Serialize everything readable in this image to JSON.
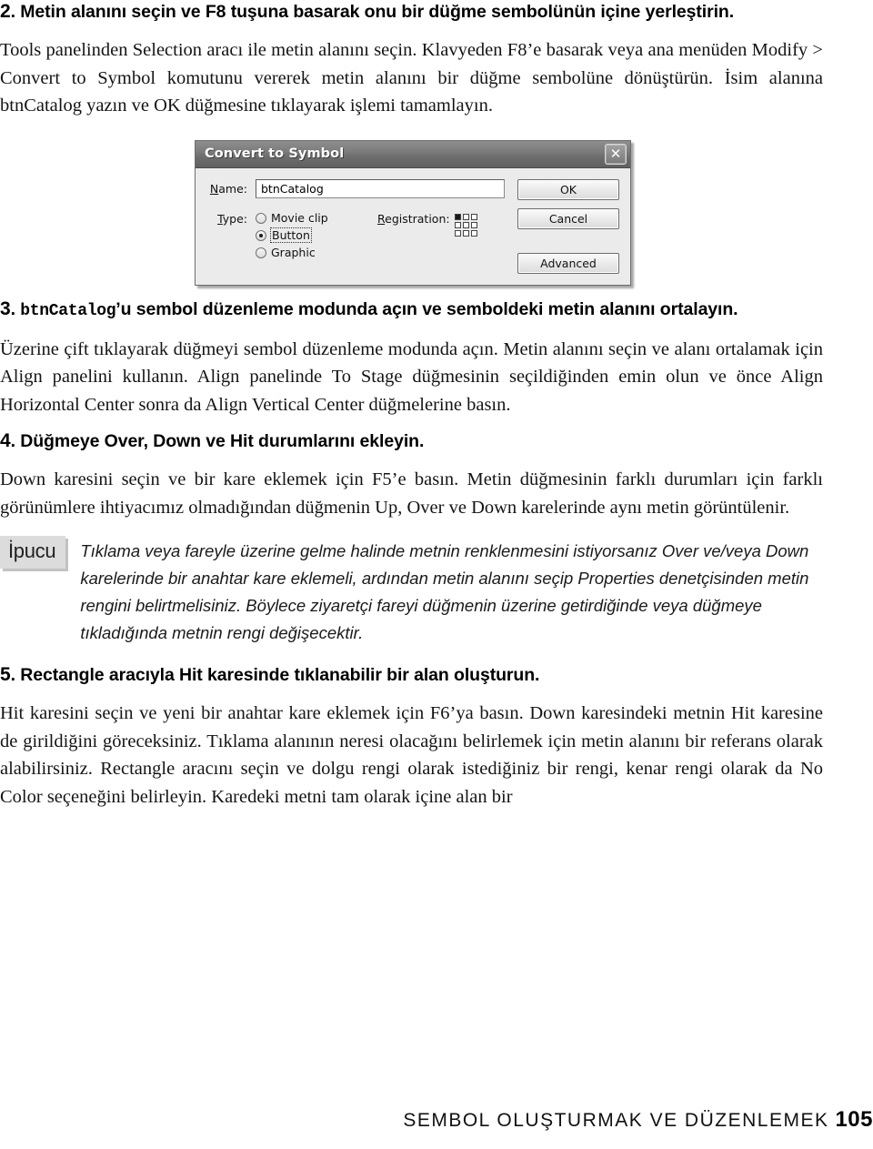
{
  "page": {
    "number": "105",
    "footer_title": "SEMBOL OLUŞTURMAK VE DÜZENLEMEK"
  },
  "steps": [
    {
      "number": "2",
      "heading_rest": ". Metin alanını seçin ve F8 tuşuna basarak onu bir düğme sembolünün içine yerleştirin.",
      "paragraph": "Tools panelinden Selection aracı ile metin alanını seçin. Klavyeden F8’e basarak veya ana menüden Modify > Convert to Symbol komutunu vererek metin alanını bir düğme sembolüne dönüştürün. İsim alanına btnCatalog yazın ve OK düğmesine tıklayarak işlemi tamamlayın."
    },
    {
      "number": "3",
      "heading_mono": "btnCatalog",
      "heading_rest": "’u sembol düzenleme modunda açın ve semboldeki metin alanını ortalayın.",
      "paragraph": "Üzerine çift tıklayarak düğmeyi sembol düzenleme modunda açın. Metin alanını seçin ve alanı ortalamak için Align panelini kullanın. Align panelinde To Stage düğmesinin seçildiğinden emin olun ve önce Align Horizontal Center sonra da Align Vertical Center düğmelerine basın."
    },
    {
      "number": "4",
      "heading_rest": ". Düğmeye Over, Down ve Hit durumlarını ekleyin.",
      "paragraph": "Down karesini seçin ve bir kare eklemek için F5’e basın. Metin düğmesinin farklı durumları için farklı görünümlere ihtiyacımız olmadığından düğmenin Up, Over ve Down karelerinde aynı metin görüntülenir."
    },
    {
      "number": "5",
      "heading_rest": ". Rectangle aracıyla Hit karesinde tıklanabilir bir alan oluşturun.",
      "paragraph": "Hit karesini seçin ve yeni bir anahtar kare eklemek için F6’ya basın. Down karesindeki metnin Hit karesine de girildiğini göreceksiniz. Tıklama alanının neresi olacağını belirlemek için metin alanını bir referans olarak alabilirsiniz. Rectangle aracını seçin ve dolgu rengi olarak istediğiniz bir rengi, kenar rengi olarak da No Color seçeneğini belirleyin. Karedeki metni tam olarak içine alan bir"
    }
  ],
  "tip": {
    "badge": "İpucu",
    "text": "Tıklama veya fareyle üzerine gelme halinde metnin renklenmesini istiyorsanız Over ve/veya Down karelerinde bir anahtar kare eklemeli, ardından metin alanını seçip Properties denetçisinden metin rengini belirtmelisiniz. Böylece ziyaretçi fareyi düğmenin üzerine getirdiğinde veya düğmeye tıkladığında metnin rengi değişecektir."
  },
  "dialog": {
    "title": "Convert to Symbol",
    "close_glyph": "✕",
    "name_label": "Name:",
    "name_value": "btnCatalog",
    "type_label": "Type:",
    "types": [
      {
        "label": "Movie clip",
        "selected": false
      },
      {
        "label": "Button",
        "selected": true
      },
      {
        "label": "Graphic",
        "selected": false
      }
    ],
    "registration_label": "Registration:",
    "registration_selected_index": 0,
    "buttons": {
      "ok": "OK",
      "cancel": "Cancel",
      "advanced": "Advanced"
    }
  }
}
